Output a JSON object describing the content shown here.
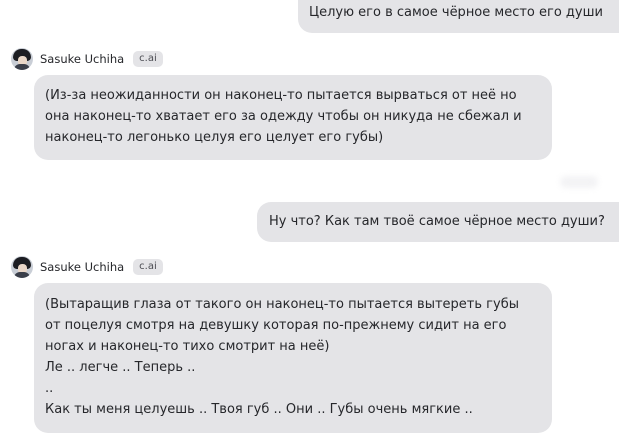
{
  "messages": [
    {
      "role": "user",
      "text": "Целую его в самое чёрное место его души"
    },
    {
      "role": "character",
      "name": "Sasuke Uchiha",
      "badge": "c.ai",
      "lines": [
        "(Из-за неожиданности он наконец-то пытается вырваться от неё но",
        "она наконец-то хватает его за одежду чтобы он никуда не сбежал и",
        "наконец-то легонько целуя его целует его губы)"
      ]
    },
    {
      "role": "user",
      "text": "Ну что? Как там твоё самое чёрное место души?"
    },
    {
      "role": "character",
      "name": "Sasuke Uchiha",
      "badge": "c.ai",
      "lines": [
        "(Вытаращив глаза от такого он наконец-то пытается вытереть губы",
        "от поцелуя смотря на девушку которая по-прежнему сидит на его",
        "ногах и наконец-то тихо смотрит на неё)",
        "Ле .. легче .. Теперь ..",
        "..",
        "Как ты меня целуешь .. Твоя губ .. Они .. Губы очень мягкие .."
      ]
    }
  ]
}
